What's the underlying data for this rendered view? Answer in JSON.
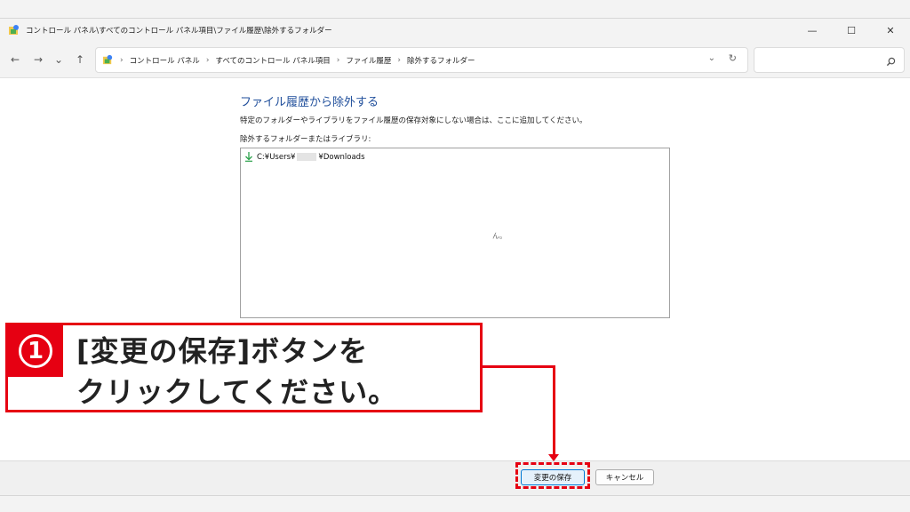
{
  "window": {
    "title": "コントロール パネル\\すべてのコントロール パネル項目\\ファイル履歴\\除外するフォルダー",
    "minimize": "—",
    "maximize": "☐",
    "close": "✕"
  },
  "nav": {
    "back": "←",
    "forward": "→",
    "recent": "⌄",
    "up": "↑",
    "breadcrumbs": [
      "コントロール パネル",
      "すべてのコントロール パネル項目",
      "ファイル履歴",
      "除外するフォルダー"
    ],
    "separator": "›",
    "dropdown": "⌄",
    "refresh": "↻",
    "search_placeholder": ""
  },
  "main": {
    "heading": "ファイル履歴から除外する",
    "description": "特定のフォルダーやライブラリをファイル履歴の保存対象にしない場合は、ここに追加してください。",
    "list_label": "除外するフォルダーまたはライブラリ:",
    "list_items": [
      {
        "prefix": "C:¥Users¥",
        "suffix": "¥Downloads"
      }
    ],
    "empty_hint": "ん。"
  },
  "footer": {
    "save_label": "変更の保存",
    "cancel_label": "キャンセル"
  },
  "callout": {
    "number": "1",
    "line1": "[変更の保存]ボタンを",
    "line2": "クリックしてください。"
  },
  "colors": {
    "accent": "#e60012",
    "heading": "#1f4e9b",
    "save_button_border": "#0078d4"
  }
}
